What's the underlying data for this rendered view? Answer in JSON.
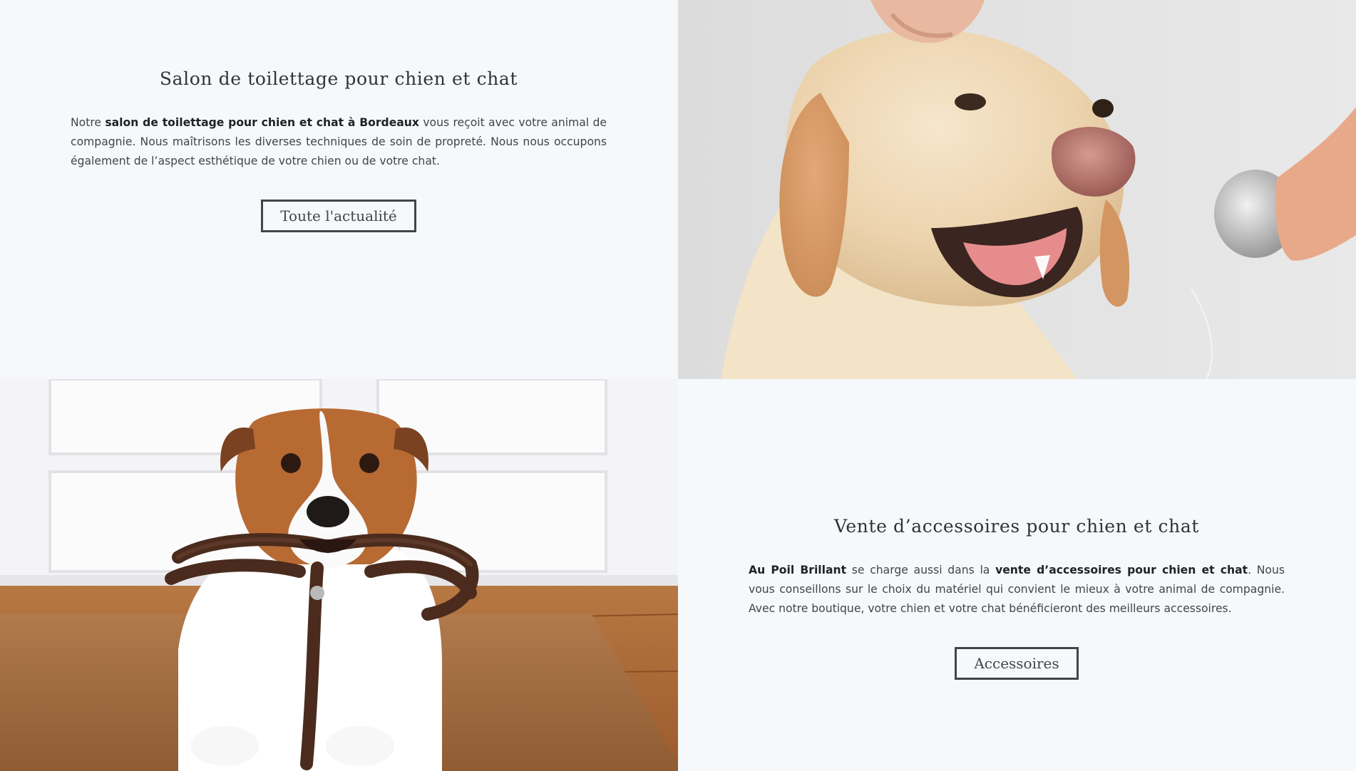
{
  "grooming": {
    "title": "Salon de toilettage pour chien et chat",
    "text": {
      "intro": "Notre ",
      "bold": "salon de toilettage pour chien et chat à Bordeaux",
      "rest": " vous reçoit avec votre animal de compagnie. Nous maîtrisons les diverses techniques de soin de propreté. Nous nous occupons également de l’aspect esthétique de votre chien ou de votre chat."
    },
    "button_label": "Toute l'actualité"
  },
  "accessories": {
    "title": "Vente d’accessoires pour chien et chat",
    "text": {
      "bold1": "Au Poil Brillant",
      "mid": " se charge aussi dans la ",
      "bold2": "vente d’accessoires pour chien et chat",
      "rest": ". Nous vous conseillons sur le choix du matériel qui convient le mieux à votre animal de compagnie. Avec notre boutique, votre chien et votre chat bénéficieront des meilleurs accessoires."
    },
    "button_label": "Accessoires"
  },
  "images": {
    "grooming_photo": "labrador-being-washed-photo",
    "accessories_photo": "jack-russell-holding-leash-photo"
  },
  "colors": {
    "background": "#f5f9fc",
    "text": "#333333",
    "button_border": "#444444"
  }
}
